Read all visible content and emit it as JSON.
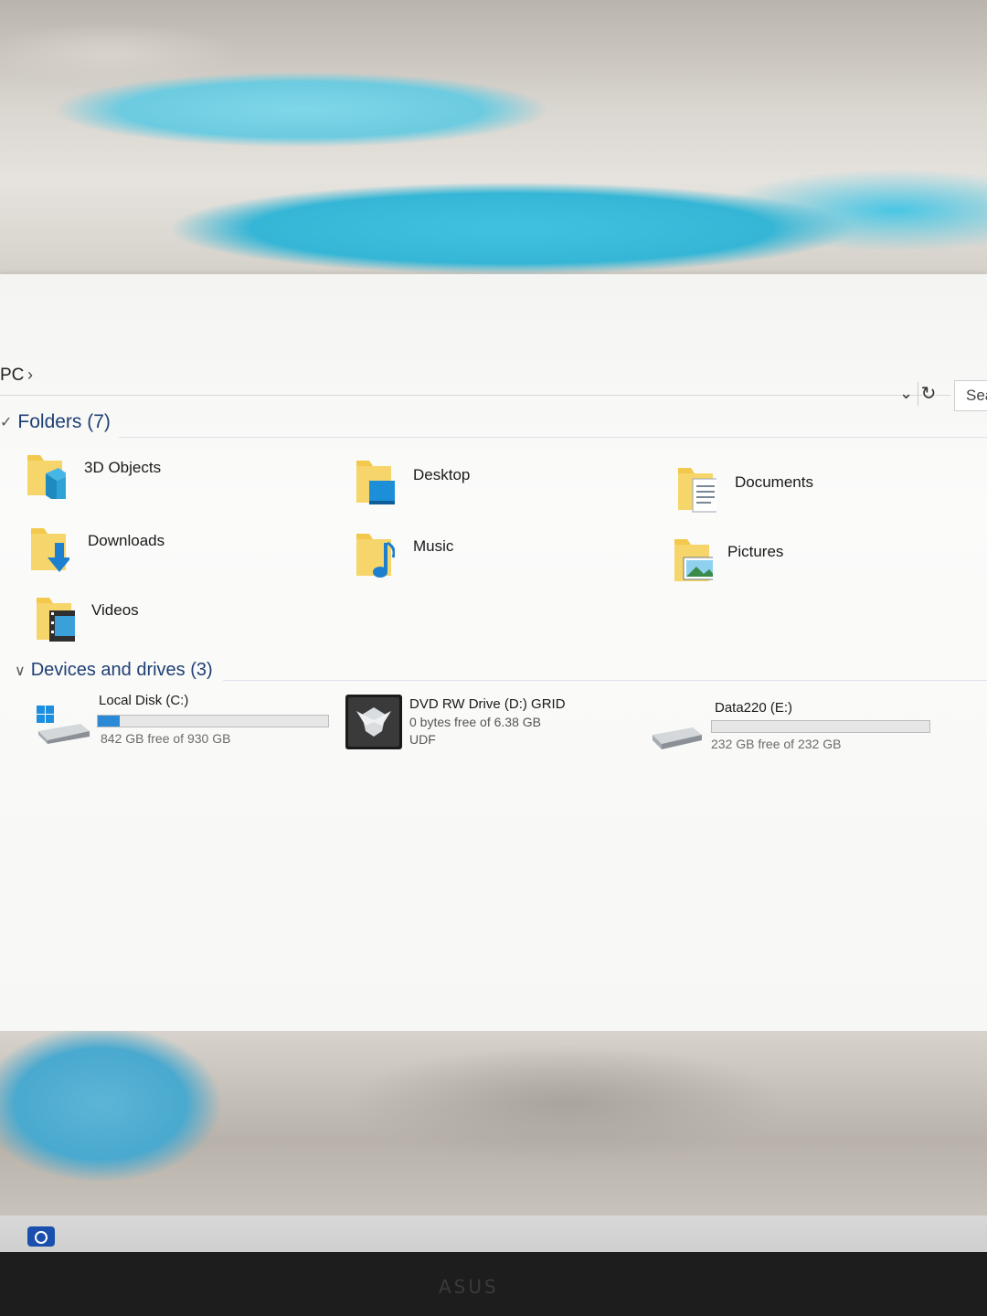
{
  "address": {
    "breadcrumb": "PC",
    "chevron": "›",
    "search_placeholder": "Sea"
  },
  "folders_section": {
    "chevron": "✓",
    "title": "Folders (7)"
  },
  "folders": [
    {
      "label": "3D Objects",
      "icon": "3d-objects-folder-icon"
    },
    {
      "label": "Desktop",
      "icon": "desktop-folder-icon"
    },
    {
      "label": "Documents",
      "icon": "documents-folder-icon"
    },
    {
      "label": "Downloads",
      "icon": "downloads-folder-icon"
    },
    {
      "label": "Music",
      "icon": "music-folder-icon"
    },
    {
      "label": "Pictures",
      "icon": "pictures-folder-icon"
    },
    {
      "label": "Videos",
      "icon": "videos-folder-icon"
    }
  ],
  "drives_section": {
    "chevron": "∨",
    "title": "Devices and drives (3)"
  },
  "drives": [
    {
      "label": "Local Disk (C:)",
      "line2": "842 GB free of 930 GB",
      "used_fraction": 0.095,
      "icon": "windows-drive-icon"
    },
    {
      "label": "DVD RW Drive (D:) GRID",
      "line2": "0 bytes free of 6.38 GB",
      "line3": "UDF",
      "icon": "dvd-disc-icon"
    },
    {
      "label": "Data220 (E:)",
      "line2": "232 GB free of 232 GB",
      "used_fraction": 0.0,
      "icon": "hard-drive-icon"
    }
  ],
  "taskbar": {
    "icon": "camera-app-icon"
  },
  "bezel": {
    "brand": "ASUS"
  },
  "colors": {
    "accent": "#2a8ad6",
    "section_title": "#1e3f73",
    "folder_yellow": "#f2c94c"
  }
}
